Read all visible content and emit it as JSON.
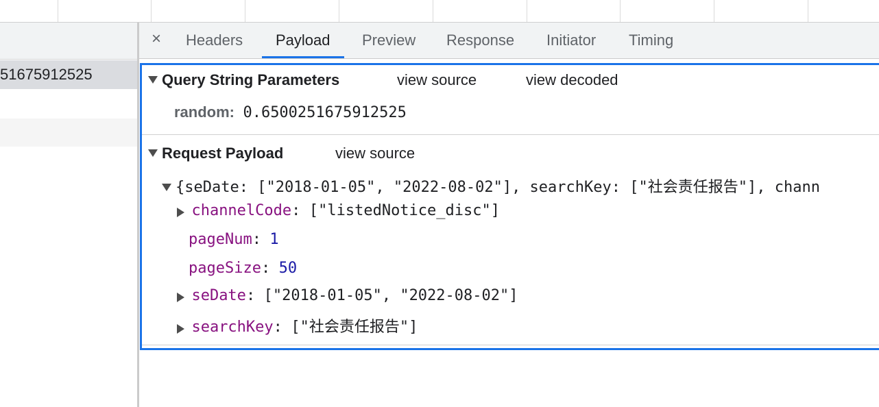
{
  "request_list": {
    "selected_row_text": "51675912525"
  },
  "tabs": [
    {
      "label": "Headers"
    },
    {
      "label": "Payload"
    },
    {
      "label": "Preview"
    },
    {
      "label": "Response"
    },
    {
      "label": "Initiator"
    },
    {
      "label": "Timing"
    }
  ],
  "active_tab": "Payload",
  "close_glyph": "×",
  "query": {
    "title": "Query String Parameters",
    "view_source": "view source",
    "view_decoded": "view decoded",
    "param_key": "random:",
    "param_value": "0.6500251675912525"
  },
  "payload": {
    "title": "Request Payload",
    "view_source": "view source",
    "summary": "{seDate: [\"2018-01-05\", \"2022-08-02\"], searchKey: [\"社会责任报告\"], chann",
    "fields": [
      {
        "key": "channelCode",
        "value": "[\"listedNotice_disc\"]"
      },
      {
        "key": "pageNum",
        "value": "1"
      },
      {
        "key": "pageSize",
        "value": "50"
      },
      {
        "key": "seDate",
        "value": "[\"2018-01-05\", \"2022-08-02\"]"
      },
      {
        "key": "searchKey",
        "value": "[\"社会责任报告\"]"
      }
    ],
    "colon": ":"
  },
  "colors": {
    "accent": "#1a73e8",
    "key": "#881280",
    "number": "#1a1aa6"
  }
}
